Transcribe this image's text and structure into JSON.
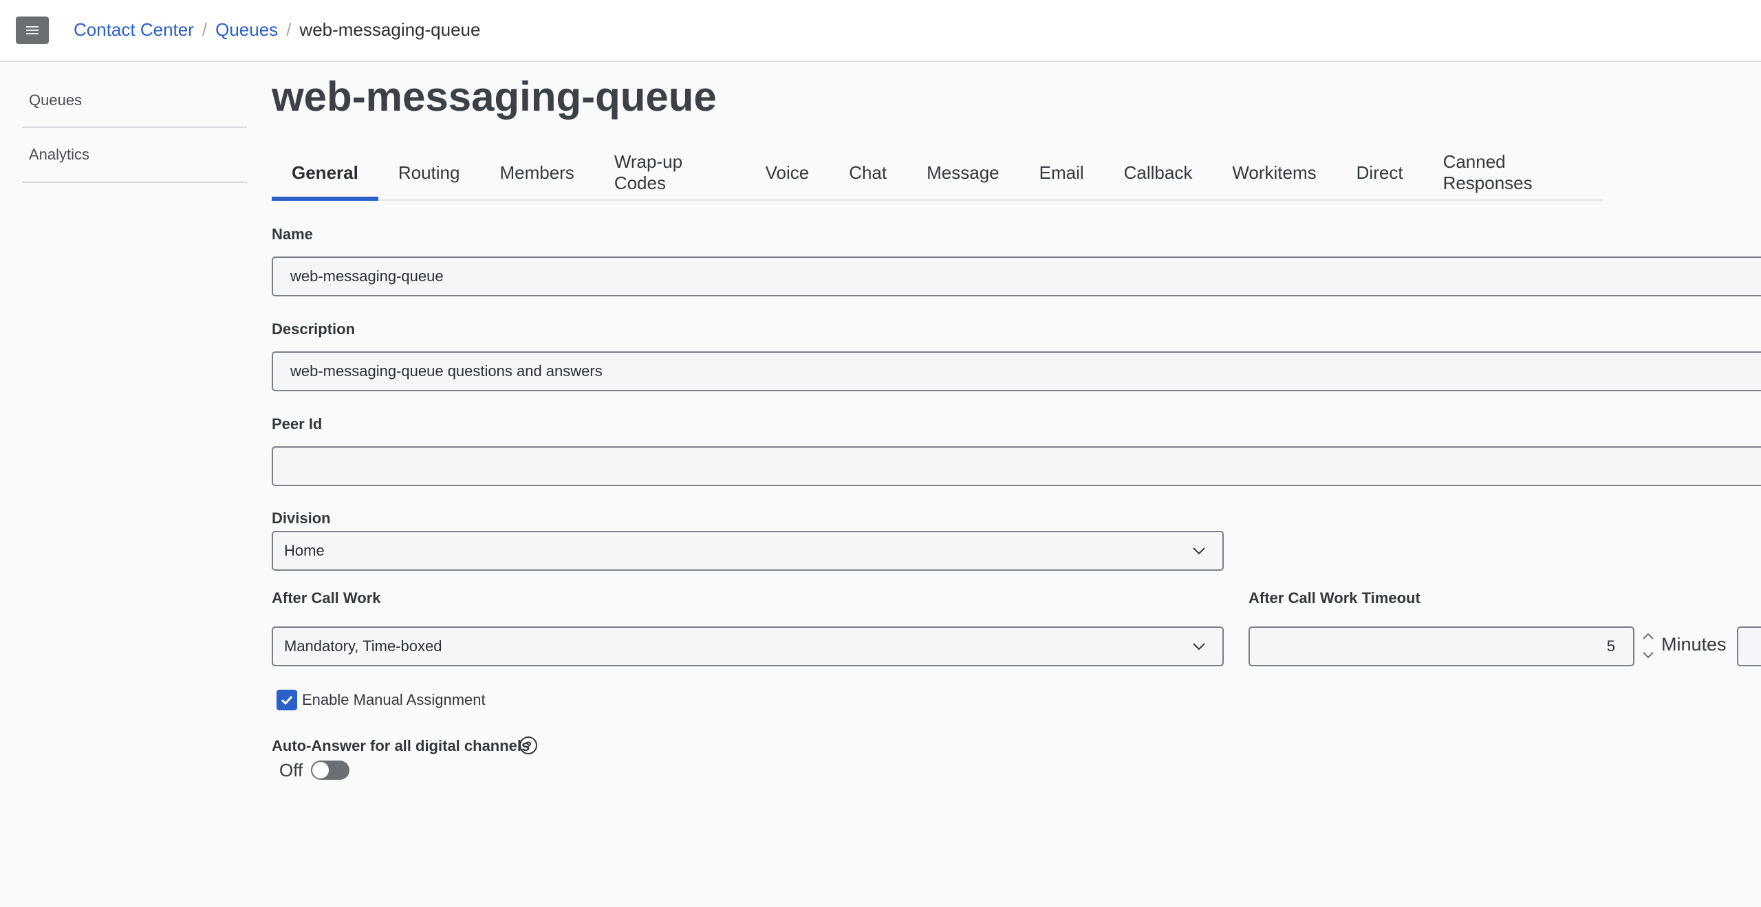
{
  "breadcrumb": {
    "items": [
      "Contact Center",
      "Queues"
    ],
    "current": "web-messaging-queue"
  },
  "sidebar": {
    "items": [
      {
        "label": "Queues"
      },
      {
        "label": "Analytics"
      }
    ]
  },
  "page": {
    "title": "web-messaging-queue"
  },
  "tabs": [
    {
      "label": "General",
      "active": true
    },
    {
      "label": "Routing"
    },
    {
      "label": "Members"
    },
    {
      "label": "Wrap-up Codes"
    },
    {
      "label": "Voice"
    },
    {
      "label": "Chat"
    },
    {
      "label": "Message"
    },
    {
      "label": "Email"
    },
    {
      "label": "Callback"
    },
    {
      "label": "Workitems"
    },
    {
      "label": "Direct"
    },
    {
      "label": "Canned Responses"
    }
  ],
  "form": {
    "name_label": "Name",
    "name_value": "web-messaging-queue",
    "description_label": "Description",
    "description_value": "web-messaging-queue questions and answers",
    "peer_id_label": "Peer Id",
    "peer_id_value": "",
    "division_label": "Division",
    "division_value": "Home",
    "acw_label": "After Call Work",
    "acw_value": "Mandatory, Time-boxed",
    "acw_timeout_label": "After Call Work Timeout",
    "acw_timeout_value": "5",
    "acw_timeout_unit": "Minutes",
    "manual_assignment_label": "Enable Manual Assignment",
    "manual_assignment_checked": true,
    "auto_answer_label": "Auto-Answer for all digital channels",
    "auto_answer_state": "Off"
  },
  "colors": {
    "accent": "#2a60c8",
    "menu_button": "#6b6f74",
    "field_border": "#7b8087"
  }
}
